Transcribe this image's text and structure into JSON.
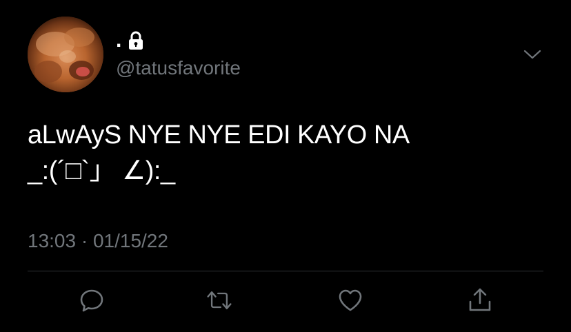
{
  "author": {
    "display_name": ".",
    "handle": "@tatusfavorite",
    "protected_icon": "lock-icon",
    "avatar_icon": "dog-avatar"
  },
  "tweet": {
    "lines": [
      "aLwAyS NYE NYE EDI KAYO NA",
      "_:(´□`」 ∠):_"
    ],
    "timestamp": "13:03 · 01/15/22"
  },
  "actions": {
    "reply_icon": "reply-icon",
    "retweet_icon": "retweet-icon",
    "like_icon": "heart-icon",
    "share_icon": "share-icon"
  },
  "colors": {
    "background": "#000000",
    "text": "#ffffff",
    "secondary_text": "#71767b",
    "icon": "#71767b",
    "divider": "#2f3336"
  }
}
